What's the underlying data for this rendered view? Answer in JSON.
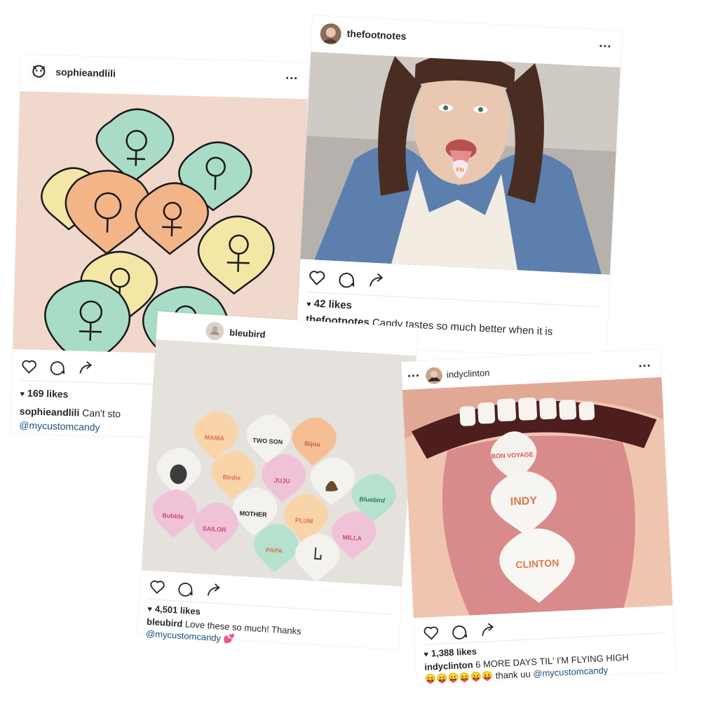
{
  "posts": [
    {
      "username": "sophieandlili",
      "more_label": "...",
      "likes": "169 likes",
      "caption_text": "Can't sto",
      "mention": "@mycustomcandy"
    },
    {
      "username": "thefootnotes",
      "more_label": "...",
      "likes": "42 likes",
      "caption_text": "Candy tastes so much better when it is Footnotes initialled!",
      "candy_text": "FN"
    },
    {
      "username": "bleubird",
      "more_label": "...",
      "likes": "4,501 likes",
      "caption_text": "Love these so much! Thanks",
      "mention": "@mycustomcandy",
      "emoji": "💕",
      "candies": [
        "MAMA",
        "TWO SON",
        "Bijou",
        "Birdie",
        "JUJU",
        "Bluebird",
        "Bubble",
        "MOTHER",
        "PLUM",
        "SAILOR",
        "PAPA",
        "MILLA"
      ]
    },
    {
      "username": "indyclinton",
      "more_label": "...",
      "likes": "1,388 likes",
      "caption_text": "6 MORE DAYS TIL' I'M FLYING HIGH",
      "caption_text2": "thank uu",
      "mention": "@mycustomcandy",
      "emoji_row": "😛😛😛😛😛😛",
      "candies": [
        "BON VOYAGE",
        "INDY",
        "CLINTON"
      ]
    }
  ],
  "colors": {
    "text": "#262626",
    "mention": "#1c4f7f",
    "mint": "#a8dcc4",
    "peach": "#f4b183",
    "butter": "#f6e8a6",
    "pink": "#f2c4d6",
    "denim": "#5d7fae",
    "tongue": "#d98b8b"
  },
  "icons": [
    "heart-icon",
    "comment-icon",
    "share-icon",
    "more-icon",
    "avatar"
  ]
}
